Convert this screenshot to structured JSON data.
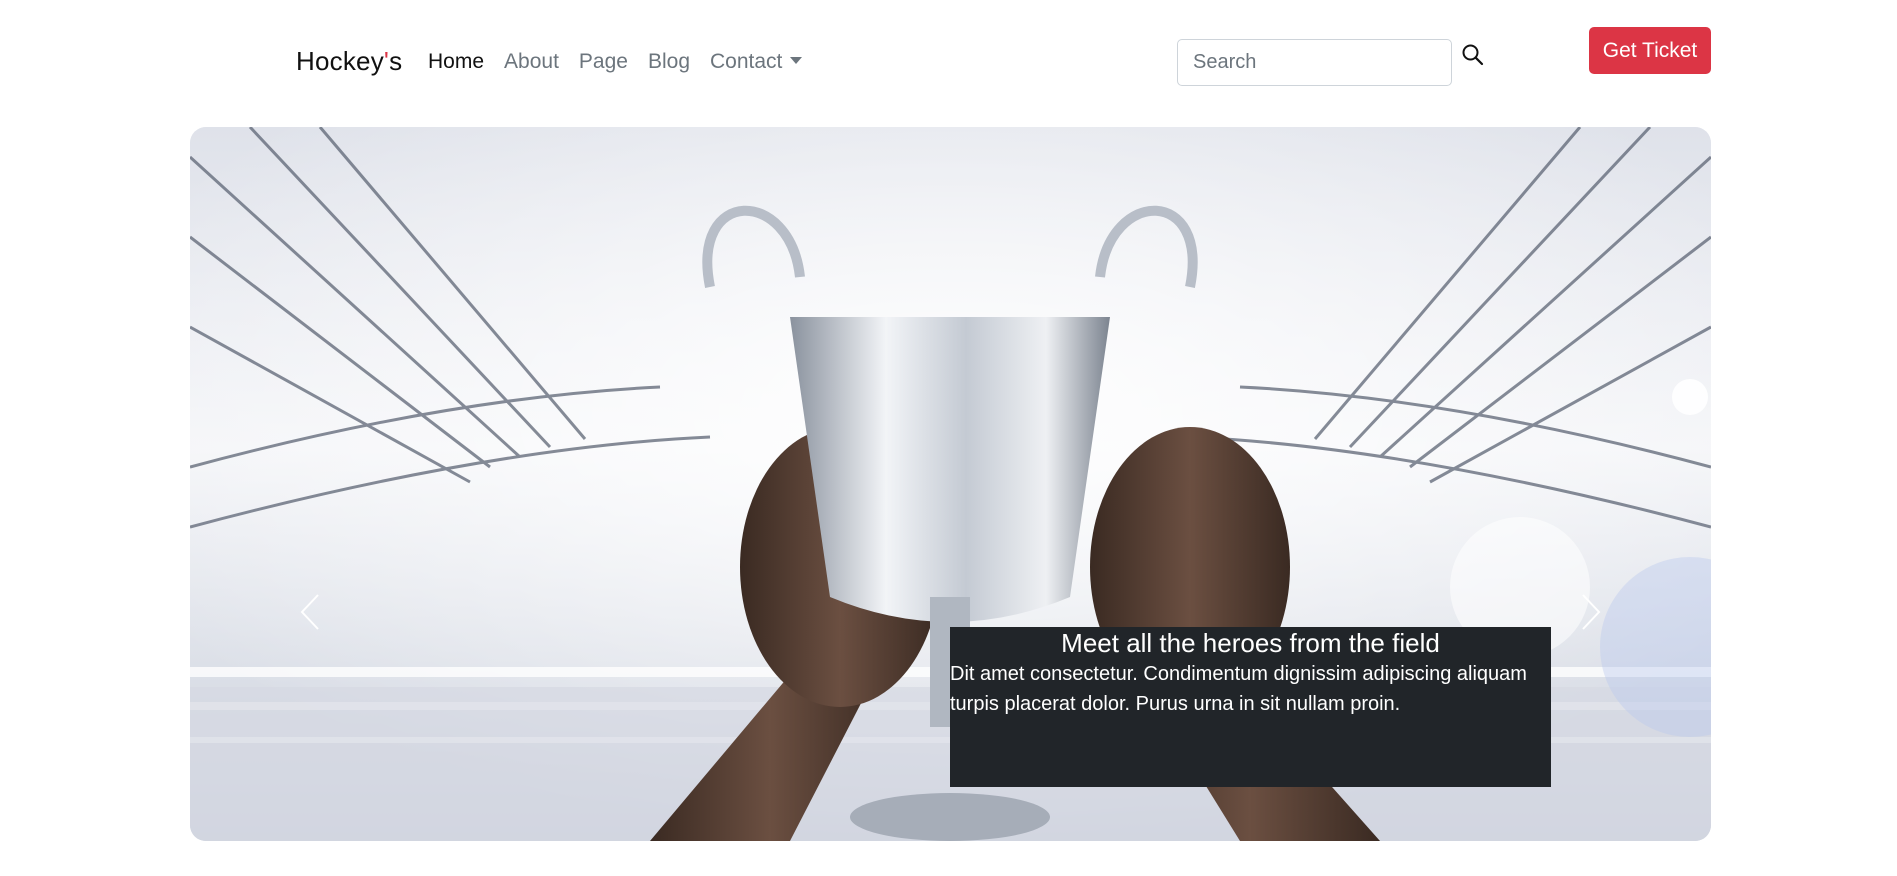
{
  "navbar": {
    "brand_main": "Hockey",
    "brand_apostrophe": "'",
    "brand_suffix": "s",
    "links": [
      "Home",
      "About",
      "Page",
      "Blog",
      "Contact"
    ],
    "search_placeholder": "Search",
    "ticket_label": "Get Ticket"
  },
  "carousel": {
    "caption_title": "Meet all the heroes from the field",
    "caption_text": "Dit amet consectetur. Condimentum dignissim adipiscing aliquam turpis placerat dolor. Purus urna in sit nullam proin."
  },
  "colors": {
    "accent": "#dc3545",
    "caption_bg": "#212529"
  }
}
